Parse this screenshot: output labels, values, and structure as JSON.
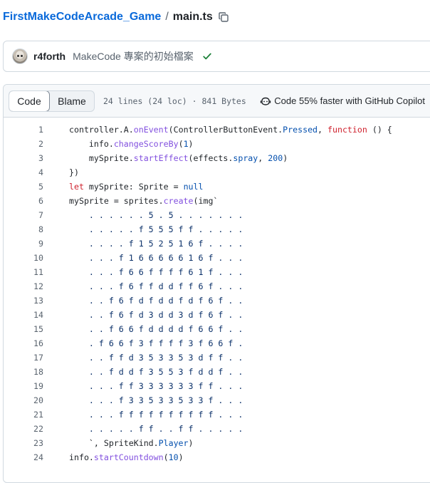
{
  "breadcrumb": {
    "repo": "FirstMakeCodeArcade_Game",
    "separator": "/",
    "file": "main.ts",
    "copy_icon": "copy-icon"
  },
  "commit": {
    "author": "r4forth",
    "message": "MakeCode 專案的初始檔案",
    "status_icon": "check-icon",
    "status_color": "#1a7f37"
  },
  "file_header": {
    "tabs": [
      {
        "label": "Code",
        "active": true
      },
      {
        "label": "Blame",
        "active": false
      }
    ],
    "info": "24 lines (24 loc) · 841 Bytes",
    "copilot": "Code 55% faster with GitHub Copilot"
  },
  "code_lines": [
    [
      [
        "controller.A.",
        ""
      ],
      [
        "onEvent",
        "f"
      ],
      [
        "(ControllerButtonEvent.",
        ""
      ],
      [
        "Pressed",
        "p"
      ],
      [
        ", ",
        ""
      ],
      [
        "function",
        "k"
      ],
      [
        " () {",
        ""
      ]
    ],
    [
      [
        "    info.",
        ""
      ],
      [
        "changeScoreBy",
        "f"
      ],
      [
        "(",
        ""
      ],
      [
        "1",
        "p"
      ],
      [
        ")",
        ""
      ]
    ],
    [
      [
        "    mySprite.",
        ""
      ],
      [
        "startEffect",
        "f"
      ],
      [
        "(effects.",
        ""
      ],
      [
        "spray",
        "p"
      ],
      [
        ", ",
        ""
      ],
      [
        "200",
        "p"
      ],
      [
        ")",
        ""
      ]
    ],
    [
      [
        "})",
        ""
      ]
    ],
    [
      [
        "let",
        "k"
      ],
      [
        " mySprite: Sprite = ",
        ""
      ],
      [
        "null",
        "p"
      ]
    ],
    [
      [
        "mySprite = sprites.",
        ""
      ],
      [
        "create",
        "f"
      ],
      [
        "(img`",
        ""
      ]
    ],
    [
      [
        "    . . . . . . 5 . 5 . . . . . . .",
        "s"
      ]
    ],
    [
      [
        "    . . . . . f 5 5 5 f f . . . . .",
        "s"
      ]
    ],
    [
      [
        "    . . . . f 1 5 2 5 1 6 f . . . .",
        "s"
      ]
    ],
    [
      [
        "    . . . f 1 6 6 6 6 6 1 6 f . . .",
        "s"
      ]
    ],
    [
      [
        "    . . . f 6 6 f f f f 6 1 f . . .",
        "s"
      ]
    ],
    [
      [
        "    . . . f 6 f f d d f f 6 f . . .",
        "s"
      ]
    ],
    [
      [
        "    . . f 6 f d f d d f d f 6 f . .",
        "s"
      ]
    ],
    [
      [
        "    . . f 6 f d 3 d d 3 d f 6 f . .",
        "s"
      ]
    ],
    [
      [
        "    . . f 6 6 f d d d d f 6 6 f . .",
        "s"
      ]
    ],
    [
      [
        "    . f 6 6 f 3 f f f f 3 f 6 6 f .",
        "s"
      ]
    ],
    [
      [
        "    . . f f d 3 5 3 3 5 3 d f f . .",
        "s"
      ]
    ],
    [
      [
        "    . . f d d f 3 5 5 3 f d d f . .",
        "s"
      ]
    ],
    [
      [
        "    . . . f f 3 3 3 3 3 3 f f . . .",
        "s"
      ]
    ],
    [
      [
        "    . . . f 3 3 5 3 3 5 3 3 f . . .",
        "s"
      ]
    ],
    [
      [
        "    . . . f f f f f f f f f f . . .",
        "s"
      ]
    ],
    [
      [
        "    . . . . . f f . . f f . . . . .",
        "s"
      ]
    ],
    [
      [
        "    `, SpriteKind.",
        ""
      ],
      [
        "Player",
        "p"
      ],
      [
        ")",
        ""
      ]
    ],
    [
      [
        "info.",
        ""
      ],
      [
        "startCountdown",
        "f"
      ],
      [
        "(",
        ""
      ],
      [
        "10",
        "p"
      ],
      [
        ")",
        ""
      ]
    ]
  ]
}
